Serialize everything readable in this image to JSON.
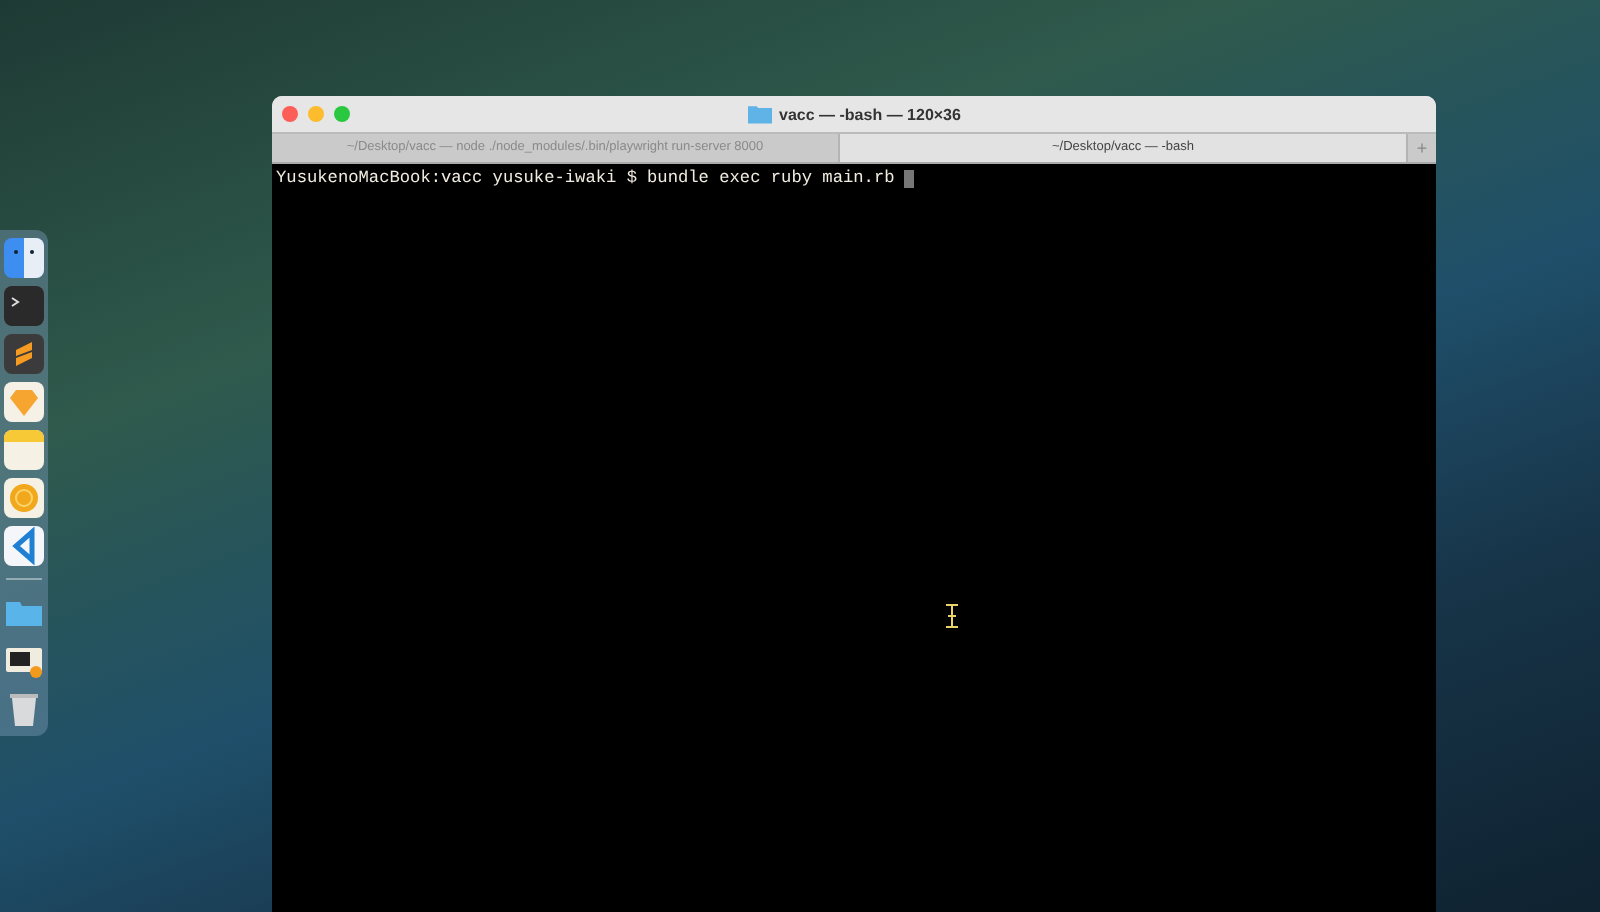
{
  "dock": {
    "items": [
      {
        "kind": "finder"
      },
      {
        "kind": "terminal"
      },
      {
        "kind": "sublime"
      },
      {
        "kind": "sketch"
      },
      {
        "kind": "notes"
      },
      {
        "kind": "coin"
      },
      {
        "kind": "vscode"
      },
      {
        "kind": "separator"
      },
      {
        "kind": "folder"
      },
      {
        "kind": "screen"
      },
      {
        "kind": "trash"
      }
    ]
  },
  "window": {
    "title": "vacc — -bash — 120×36",
    "tabs": [
      {
        "label": "~/Desktop/vacc — node ./node_modules/.bin/playwright run-server 8000",
        "selected": false
      },
      {
        "label": "~/Desktop/vacc — -bash",
        "selected": true
      }
    ],
    "new_tab": "+",
    "terminal": {
      "prompt": "YusukenoMacBook:vacc yusuke-iwaki $",
      "command": "bundle exec ruby main.rb"
    }
  }
}
